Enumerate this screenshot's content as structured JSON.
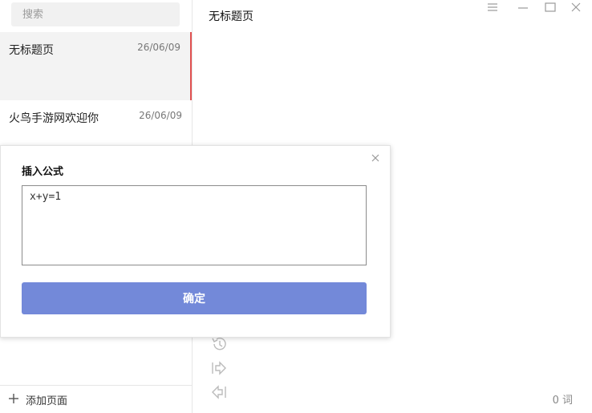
{
  "sidebar": {
    "search": {
      "placeholder": "搜索",
      "value": ""
    },
    "pages": [
      {
        "title": "无标题页",
        "date": "26/06/09",
        "active": true
      },
      {
        "title": "火鸟手游网欢迎你",
        "date": "26/06/09",
        "active": false
      }
    ],
    "add_page_label": "添加页面",
    "accent": "#e05050"
  },
  "main": {
    "page_title": "无标题页",
    "word_count": "0 词",
    "icons": [
      "menu-icon",
      "minimize-icon",
      "maximize-icon",
      "close-icon",
      "history-icon",
      "forward-icon",
      "back-icon"
    ]
  },
  "dialog": {
    "title": "插入公式",
    "formula": "x+y=1",
    "confirm_label": "确定",
    "confirm_color": "#7389d9"
  }
}
